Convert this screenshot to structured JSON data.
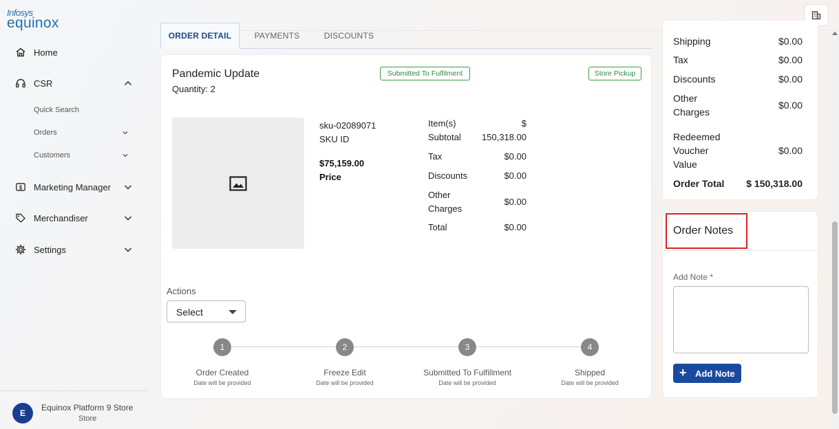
{
  "brand": {
    "line1": "Infosys",
    "line2": "equinox"
  },
  "sidebar": {
    "items": [
      {
        "label": "Home",
        "icon": "home-icon"
      },
      {
        "label": "CSR",
        "icon": "headset-icon",
        "expanded": true
      },
      {
        "label": "Marketing Manager",
        "icon": "dollar-card-icon"
      },
      {
        "label": "Merchandiser",
        "icon": "tag-icon"
      },
      {
        "label": "Settings",
        "icon": "gear-icon"
      }
    ],
    "csr_sub": [
      {
        "label": "Quick Search"
      },
      {
        "label": "Orders"
      },
      {
        "label": "Customers"
      }
    ],
    "footer": {
      "avatar": "E",
      "store_name": "Equinox Platform 9 Store",
      "role": "Store"
    }
  },
  "tabs": [
    {
      "label": "ORDER DETAIL",
      "active": true
    },
    {
      "label": "PAYMENTS",
      "active": false
    },
    {
      "label": "DISCOUNTS",
      "active": false
    }
  ],
  "item": {
    "title": "Pandemic Update",
    "quantity": "Quantity: 2",
    "badge_status": "Submitted To Fulfilment",
    "badge_fulfilment": "Store Pickup",
    "sku_value": "sku-02089071",
    "sku_label": "SKU ID",
    "price_value": "$75,159.00",
    "price_label": "Price",
    "summary": {
      "items_label_1": "Item(s)",
      "items_label_2": "Subtotal",
      "items_value_1": "$",
      "items_value_2": "150,318.00",
      "tax_label": "Tax",
      "tax_value": "$0.00",
      "discounts_label": "Discounts",
      "discounts_value": "$0.00",
      "other_label_1": "Other",
      "other_label_2": "Charges",
      "other_value": "$0.00",
      "total_label": "Total",
      "total_value": "$0.00"
    }
  },
  "actions": {
    "label": "Actions",
    "select_value": "Select"
  },
  "progress": {
    "steps": [
      {
        "number": "1",
        "title": "Order Created",
        "sub": "Date will be provided"
      },
      {
        "number": "2",
        "title": "Freeze Edit",
        "sub": "Date will be provided"
      },
      {
        "number": "3",
        "title": "Submitted To Fulfillment",
        "sub": "Date will be provided"
      },
      {
        "number": "4",
        "title": "Shipped",
        "sub": "Date will be provided"
      }
    ]
  },
  "order_summary": {
    "shipping_label": "Shipping",
    "shipping_value": "$0.00",
    "tax_label": "Tax",
    "tax_value": "$0.00",
    "discounts_label": "Discounts",
    "discounts_value": "$0.00",
    "other_label_1": "Other",
    "other_label_2": "Charges",
    "other_value": "$0.00",
    "voucher_label_1": "Redeemed",
    "voucher_label_2": "Voucher",
    "voucher_label_3": "Value",
    "voucher_value": "$0.00",
    "total_label": "Order Total",
    "total_value": "$ 150,318.00"
  },
  "notes": {
    "title": "Order Notes",
    "field_label": "Add Note *",
    "field_value": "",
    "button_label": "Add Note"
  },
  "colors": {
    "primary": "#1a4aa0",
    "badge_green": "#2f8a3e",
    "highlight_red": "#e02020",
    "brand_blue": "#1f6fb6"
  }
}
